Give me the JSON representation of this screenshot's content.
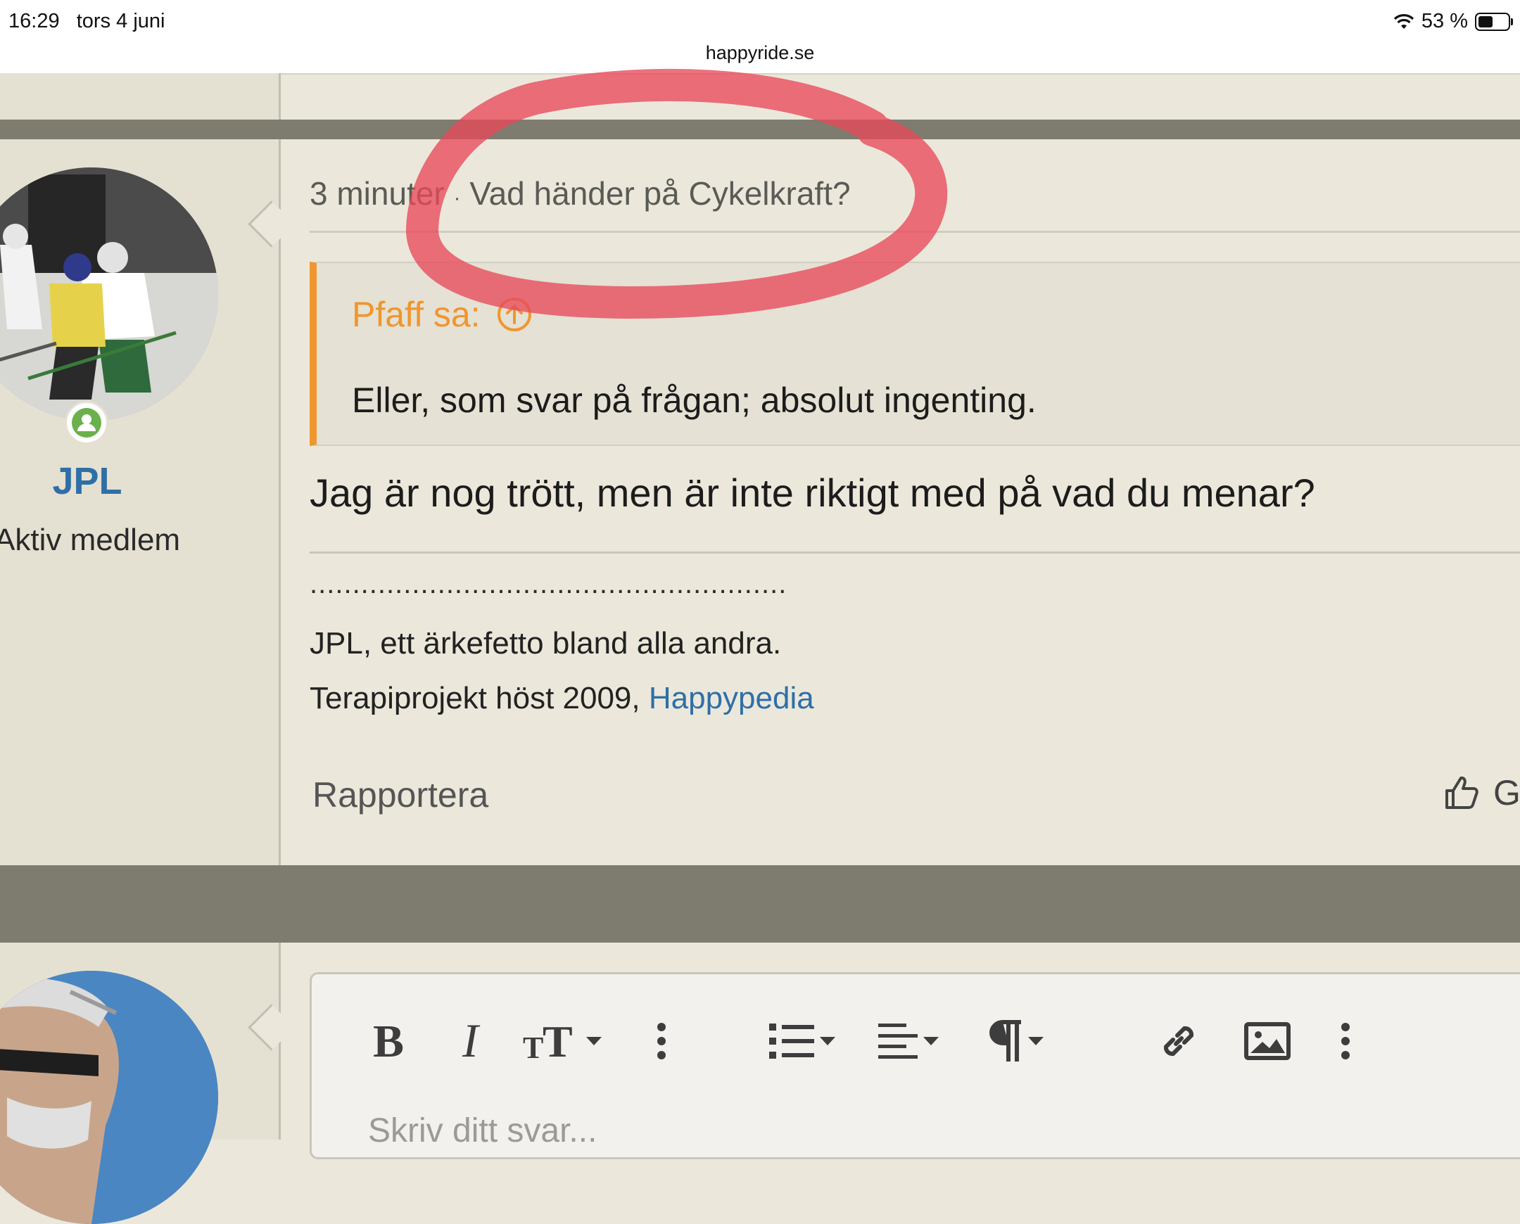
{
  "status_bar": {
    "time": "16:29",
    "date": "tors 4 juni",
    "battery": "53 %",
    "url": "happyride.se"
  },
  "previous_post": {
    "user_role_fragment": "Aktiv medlem"
  },
  "post": {
    "meta_time": "3 minuter",
    "meta_separator": "·",
    "meta_thread": "Vad händer på Cykelkraft?",
    "username": "JPL",
    "user_role": "Aktiv medlem",
    "quote": {
      "author": "Pfaff sa:",
      "text": "Eller, som svar på frågan; absolut ingenting."
    },
    "message": "Jag är nog trött, men är inte riktigt med på vad du menar?",
    "signature": {
      "dots": "........................................................",
      "line1": "JPL, ett ärkefetto bland alla andra.",
      "line2_prefix": "Terapiprojekt höst 2009, ",
      "line2_link": "Happypedia"
    },
    "actions": {
      "report": "Rapportera",
      "like_fragment": "G"
    }
  },
  "reply_editor": {
    "placeholder": "Skriv ditt svar..."
  },
  "colors": {
    "page_bg": "#ebe8db",
    "separator": "#7d7c6f",
    "link": "#2f6fa8",
    "quote_accent": "#f0962e",
    "annotation": "#e8495a"
  }
}
